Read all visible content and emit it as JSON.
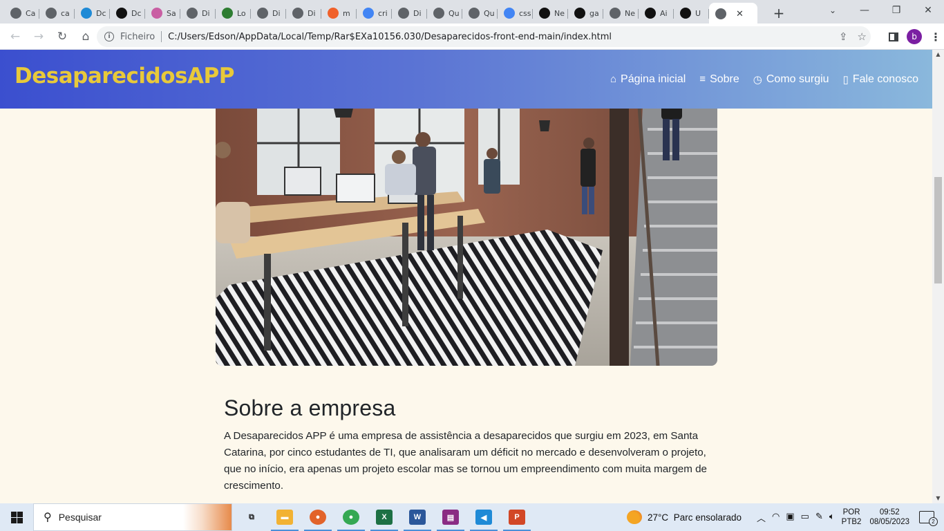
{
  "browser": {
    "tabs": [
      {
        "label": "Ca",
        "icon": "globe-icon",
        "color": "#5f6368"
      },
      {
        "label": "ca",
        "icon": "globe-icon",
        "color": "#5f6368"
      },
      {
        "label": "Dc",
        "icon": "vscode-icon",
        "color": "#1f8ad6"
      },
      {
        "label": "Dc",
        "icon": "terminal-icon",
        "color": "#111111"
      },
      {
        "label": "Sa",
        "icon": "canva-icon",
        "color": "#c95fa3"
      },
      {
        "label": "Di",
        "icon": "globe-icon",
        "color": "#5f6368"
      },
      {
        "label": "Lo",
        "icon": "puzzle-icon",
        "color": "#2e7d32"
      },
      {
        "label": "Di",
        "icon": "globe-icon",
        "color": "#5f6368"
      },
      {
        "label": "Di",
        "icon": "globe-icon",
        "color": "#5f6368"
      },
      {
        "label": "m",
        "icon": "brave-icon",
        "color": "#f0612a"
      },
      {
        "label": "cri",
        "icon": "google-icon",
        "color": "#4285f4"
      },
      {
        "label": "Di",
        "icon": "globe-icon",
        "color": "#5f6368"
      },
      {
        "label": "Qu",
        "icon": "globe-icon",
        "color": "#5f6368"
      },
      {
        "label": "Qu",
        "icon": "globe-icon",
        "color": "#5f6368"
      },
      {
        "label": "css",
        "icon": "google-icon",
        "color": "#4285f4"
      },
      {
        "label": "Ne",
        "icon": "github-icon",
        "color": "#111111"
      },
      {
        "label": "ga",
        "icon": "github-icon",
        "color": "#111111"
      },
      {
        "label": "Ne",
        "icon": "globe-icon",
        "color": "#5f6368"
      },
      {
        "label": "Ai",
        "icon": "github-icon",
        "color": "#111111"
      },
      {
        "label": "U",
        "icon": "github-icon",
        "color": "#111111"
      }
    ],
    "active_tab": {
      "label": "",
      "icon": "globe-icon",
      "close": "✕"
    },
    "new_tab": "+",
    "address": {
      "scheme_label": "Ficheiro",
      "url": "C:/Users/Edson/AppData/Local/Temp/Rar$EXa10156.030/Desaparecidos-front-end-main/index.html"
    },
    "profile_initial": "b"
  },
  "site": {
    "brand": "DesaparecidosAPP",
    "brand_color": "#e8c93a",
    "nav": [
      {
        "label": "Página inicial",
        "icon": "home-icon",
        "glyph": "⌂"
      },
      {
        "label": "Sobre",
        "icon": "list-icon",
        "glyph": "≡"
      },
      {
        "label": "Como surgiu",
        "icon": "clock-icon",
        "glyph": "◷"
      },
      {
        "label": "Fale conosco",
        "icon": "phone-icon",
        "glyph": "▯"
      }
    ],
    "hero_image": "office-coworking-photo",
    "about": {
      "title": "Sobre a empresa",
      "text": "A Desaparecidos APP é uma empresa de assistência a desaparecidos que surgiu em 2023, em Santa Catarina, por cinco estudantes de TI, que analisaram um déficit no mercado e desenvolveram o projeto, que no início, era apenas um projeto escolar mas se tornou um empreendimento com muita margem de crescimento."
    }
  },
  "taskbar": {
    "search_placeholder": "Pesquisar",
    "apps": [
      {
        "name": "task-view-icon",
        "glyph": "⧉",
        "color": "#1a1a1a",
        "running": false
      },
      {
        "name": "file-explorer-icon",
        "glyph": "▬",
        "color": "#f2b233",
        "running": true
      },
      {
        "name": "firefox-icon",
        "glyph": "●",
        "color": "#e2632a",
        "running": true
      },
      {
        "name": "chrome-icon",
        "glyph": "●",
        "color": "#34a853",
        "running": true
      },
      {
        "name": "excel-icon",
        "glyph": "X",
        "color": "#1d7044",
        "running": true
      },
      {
        "name": "word-icon",
        "glyph": "W",
        "color": "#2b579a",
        "running": true
      },
      {
        "name": "winrar-icon",
        "glyph": "▤",
        "color": "#8a2b83",
        "running": true
      },
      {
        "name": "vscode-icon",
        "glyph": "◀",
        "color": "#1f8ad6",
        "running": true
      },
      {
        "name": "powerpoint-icon",
        "glyph": "P",
        "color": "#d24726",
        "running": true
      }
    ],
    "weather": {
      "temp": "27°C",
      "desc": "Parc ensolarado"
    },
    "lang": {
      "line1": "POR",
      "line2": "PTB2"
    },
    "clock": {
      "time": "09:52",
      "date": "08/05/2023"
    },
    "notifications": "2"
  }
}
